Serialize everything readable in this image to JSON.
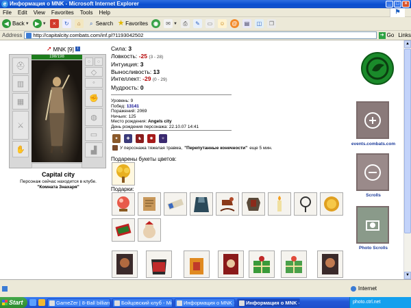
{
  "window": {
    "title": "Информация о MNK - Microsoft Internet Explorer"
  },
  "menu": [
    "File",
    "Edit",
    "View",
    "Favorites",
    "Tools",
    "Help"
  ],
  "toolbar": {
    "back": "Back",
    "search": "Search",
    "favorites": "Favorites"
  },
  "address": {
    "label": "Address",
    "url": "http://capitalcity.combats.com/inf.pl?1193042502",
    "go": "Go",
    "links": "Links"
  },
  "character": {
    "nick": "MNK",
    "level": "[9]",
    "hp": "198/198",
    "city": "Capital city",
    "club_line": "Персонаж сейчас находится в клубе.",
    "club_room": "\"Комната Знахаря\""
  },
  "stats": [
    {
      "label": "Сила:",
      "value": "3",
      "neg": false,
      "range": ""
    },
    {
      "label": "Ловкость:",
      "value": "-25",
      "neg": true,
      "range": "(3 - 28)"
    },
    {
      "label": "Интуиция:",
      "value": "3",
      "neg": false,
      "range": ""
    },
    {
      "label": "Выносливость:",
      "value": "13",
      "neg": false,
      "range": ""
    },
    {
      "label": "Интеллект:",
      "value": "-29",
      "neg": true,
      "range": "(0 - 29)"
    },
    {
      "label": "Мудрость:",
      "value": "0",
      "neg": false,
      "range": ""
    }
  ],
  "info": {
    "level_label": "Уровень:",
    "level": "9",
    "wins_label": "Побед:",
    "wins": "13141",
    "losses_label": "Поражений:",
    "losses": "2069",
    "draws_label": "Ничьих:",
    "draws": "125",
    "birthplace_label": "Место рождения:",
    "birthplace": "Angels city",
    "birthday_label": "День рождения персонажа:",
    "birthday": "22.10.07 14:41"
  },
  "trauma": {
    "text": "У персонажа тяжелая травма,",
    "name": "\"Перепутанные конечности\"",
    "suffix": "еще 5 мин."
  },
  "flowers_label": "Подарены букеты цветов:",
  "gifts_label": "Подарки:",
  "right": {
    "events": "events.combats.com",
    "scrolls": "Scrolls",
    "photo": "Photo Scrolls"
  },
  "status": {
    "zone": "Internet"
  },
  "taskbar": {
    "start": "Start",
    "tasks": [
      "GameZer | 8-Ball billiards...",
      "Бойцовский клуб - Micr...",
      "Информация о MNK - Mi...",
      "Информация о МNK - ..."
    ],
    "tray": "photo.ctrl.net"
  }
}
